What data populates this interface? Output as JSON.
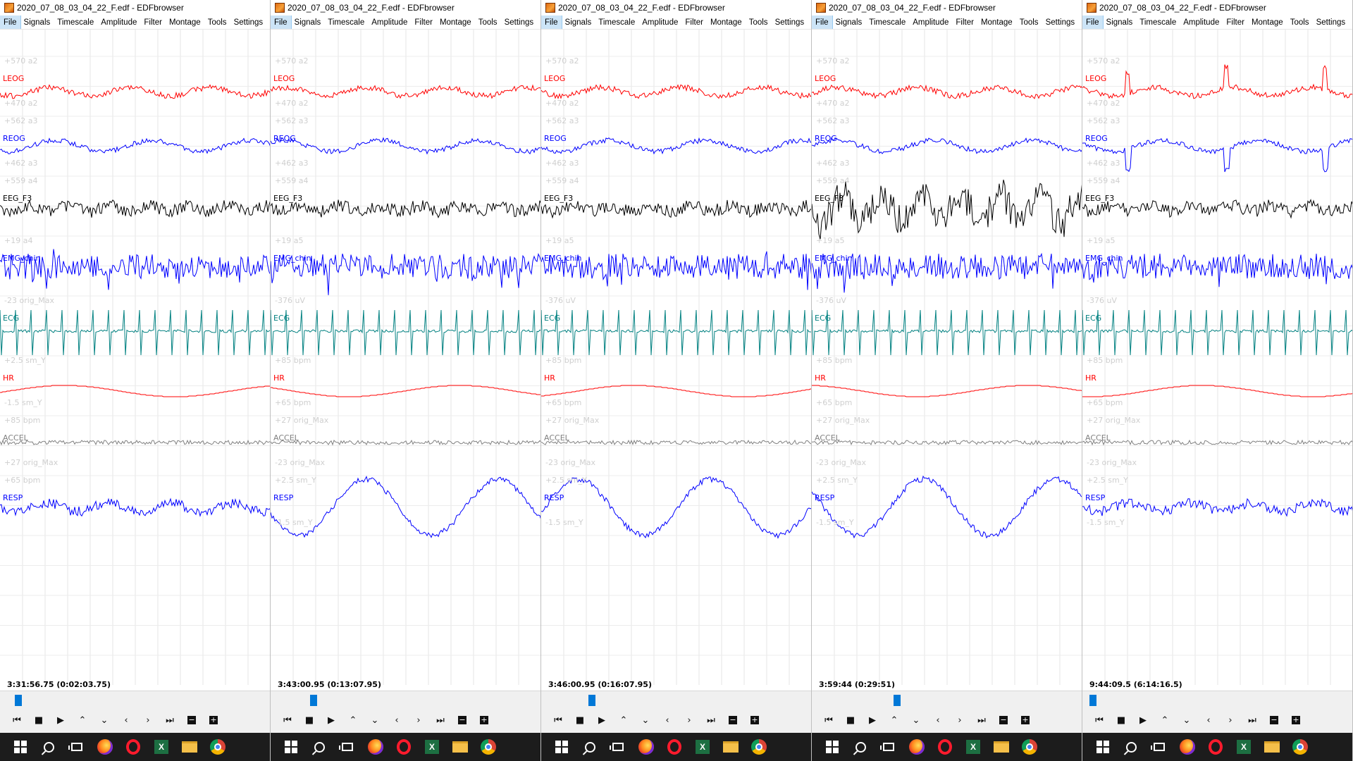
{
  "window_title": "2020_07_08_03_04_22_F.edf - EDFbrowser",
  "menu": [
    "File",
    "Signals",
    "Timescale",
    "Amplitude",
    "Filter",
    "Montage",
    "Tools",
    "Settings"
  ],
  "active_menu": "File",
  "controls": [
    "⏮",
    "■",
    "▶",
    "⌃",
    "⌄",
    "‹",
    "›",
    "⏭",
    "−",
    "+"
  ],
  "taskbar_icons": [
    "windows-start-icon",
    "search-icon",
    "task-view-icon",
    "firefox-icon",
    "opera-icon",
    "excel-icon",
    "file-explorer-icon",
    "chrome-icon"
  ],
  "signals": [
    {
      "name": "LEOG",
      "color": "#ff0000"
    },
    {
      "name": "REOG",
      "color": "#0000ff"
    },
    {
      "name": "EEG_F3",
      "color": "#000000"
    },
    {
      "name": "EMG_chin",
      "color": "#0000ff"
    },
    {
      "name": "ECG",
      "color": "#008080"
    },
    {
      "name": "HR",
      "color": "#ff0000"
    },
    {
      "name": "ACCEL",
      "color": "#808080"
    },
    {
      "name": "RESP",
      "color": "#0000ff"
    }
  ],
  "panels": [
    {
      "timestamp": "3:31:56.75 (0:02:03.75)",
      "scroll_position": 0.03,
      "scales": [
        "+570 a2",
        "+470 a2",
        "+562 a3",
        "+462 a3",
        "+559 a4",
        "+19 a4",
        "-23 orig_Max",
        "+2.5 sm_Y",
        "-1.5 sm_Y",
        "+85 bpm",
        "+27 orig_Max",
        "+65 bpm"
      ]
    },
    {
      "timestamp": "3:43:00.95 (0:13:07.95)",
      "scroll_position": 0.13,
      "scales": [
        "+570 a2",
        "+470 a2",
        "+562 a3",
        "+462 a3",
        "+559 a4",
        "+19 a5",
        "-376 uV",
        "+85 bpm",
        "+65 bpm",
        "+27 orig_Max",
        "-23 orig_Max",
        "+2.5 sm_Y",
        "-1.5 sm_Y"
      ]
    },
    {
      "timestamp": "3:46:00.95 (0:16:07.95)",
      "scroll_position": 0.16,
      "scales": [
        "+570 a2",
        "+470 a2",
        "+562 a3",
        "+462 a3",
        "+559 a4",
        "+19 a5",
        "-376 uV",
        "+85 bpm",
        "+65 bpm",
        "+27 orig_Max",
        "-23 orig_Max",
        "+2.5 sm_Y",
        "-1.5 sm_Y"
      ]
    },
    {
      "timestamp": "3:59:44 (0:29:51)",
      "scroll_position": 0.3,
      "scales": [
        "+570 a2",
        "+470 a2",
        "+562 a3",
        "+462 a3",
        "+559 a4",
        "+19 a5",
        "-376 uV",
        "+85 bpm",
        "+65 bpm",
        "+27 orig_Max",
        "-23 orig_Max",
        "+2.5 sm_Y",
        "-1.5 sm_Y"
      ]
    },
    {
      "timestamp": "9:44:09.5 (6:14:16.5)",
      "scroll_position": 0.0,
      "scales": [
        "+570 a2",
        "+470 a2",
        "+562 a3",
        "+462 a3",
        "+559 a4",
        "+19 a5",
        "-376 uV",
        "+85 bpm",
        "+65 bpm",
        "+27 orig_Max",
        "-23 orig_Max",
        "+2.5 sm_Y",
        "-1.5 sm_Y"
      ]
    }
  ]
}
